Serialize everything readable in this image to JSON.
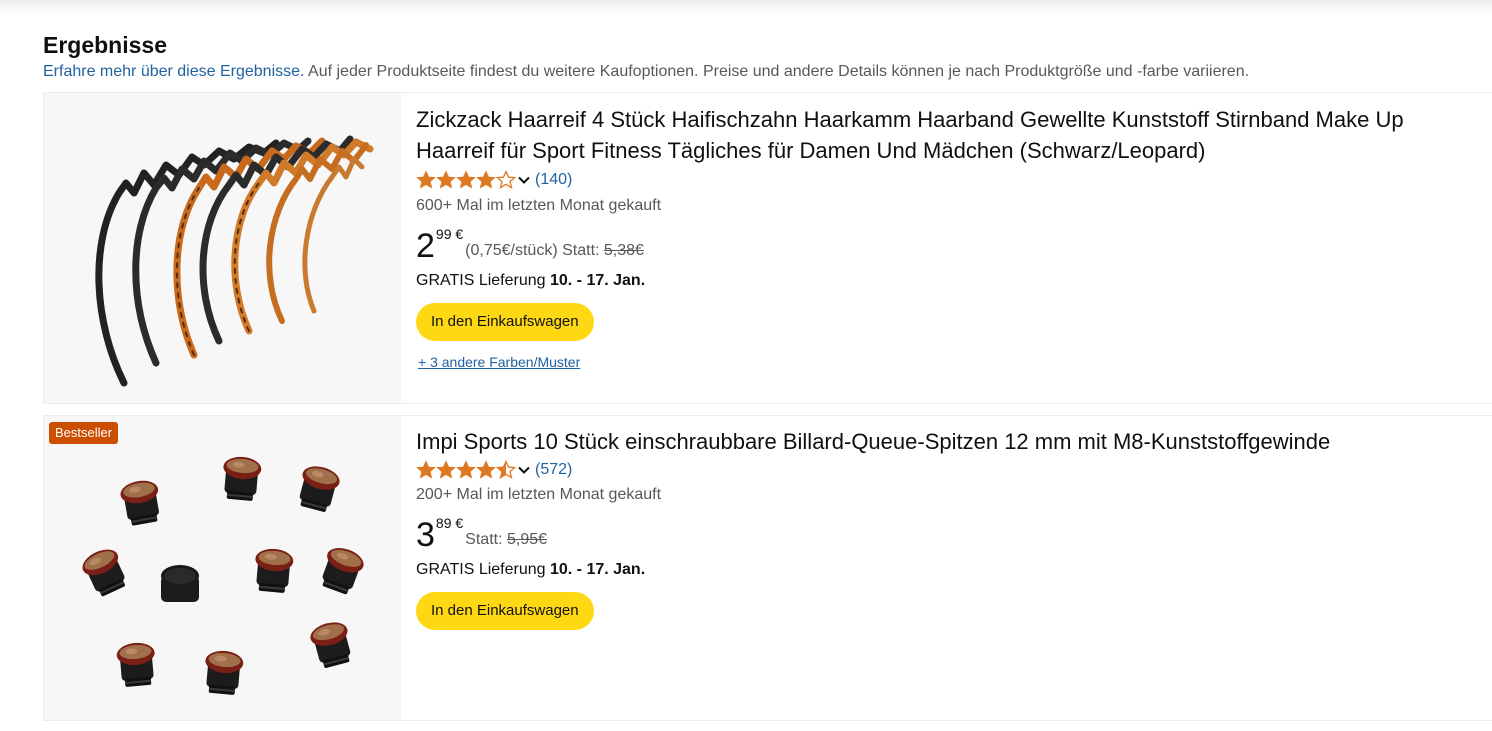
{
  "results": {
    "title": "Ergebnisse",
    "learn_more_link": "Erfahre mehr über diese Ergebnisse.",
    "subtitle": " Auf jeder Produktseite findest du weitere Kaufoptionen. Preise und andere Details können je nach Produktgröße und -farbe variieren."
  },
  "colors": {
    "star": "#de7921",
    "link": "#2162a1",
    "cart_button": "#ffd814",
    "badge": "#cc4e00"
  },
  "products": [
    {
      "title_line1": "Zickzack Haarreif 4 Stück Haifischzahn Haarkamm Haarband Gewellte Kunststoff Stirnband Make Up",
      "title_line2": "Haarreif für Sport Fitness Tägliches für Damen Und Mädchen (Schwarz/Leopard)",
      "rating": 4.0,
      "rating_count": "(140)",
      "bought": "600+ Mal im letzten Monat gekauft",
      "price_whole": "2",
      "price_fraction": "99 €",
      "unit_price": "(0,75€/stück) Statt: ",
      "old_price": "5,38€",
      "delivery_prefix": "GRATIS Lieferung ",
      "delivery_date": "10. - 17. Jan.",
      "cart_label": "In den Einkaufswagen",
      "variants": "+ 3 andere Farben/Muster",
      "image_icon": "headband-product-image"
    },
    {
      "badge": "Bestseller",
      "title_line1": "Impi Sports 10 Stück einschraubbare Billard-Queue-Spitzen 12 mm mit M8-Kunststoffgewinde",
      "rating": 4.5,
      "rating_count": "(572)",
      "bought": "200+ Mal im letzten Monat gekauft",
      "price_whole": "3",
      "price_fraction": "89 €",
      "unit_price": "Statt: ",
      "old_price": "5,95€",
      "delivery_prefix": "GRATIS Lieferung ",
      "delivery_date": "10. - 17. Jan.",
      "cart_label": "In den Einkaufswagen",
      "image_icon": "cue-tips-product-image"
    }
  ]
}
